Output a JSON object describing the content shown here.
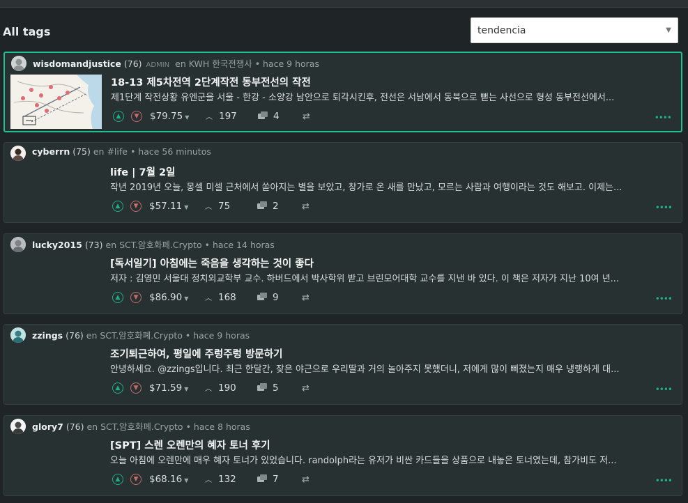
{
  "header": {
    "title": "All tags"
  },
  "sort_select": {
    "value": "tendencia"
  },
  "colors": {
    "accent": "#1fbf8f",
    "upvote": "#1fae87",
    "downvote": "#c76a6a",
    "background": "#1f2526",
    "card": "#273132"
  },
  "posts": [
    {
      "author": "wisdomandjustice",
      "rep": "(76)",
      "badge": "ADMIN",
      "community": "en KWH 한국전쟁사",
      "time": "• hace 9 horas",
      "title": "18-13 제5차전역 2단계작전 동부전선의 작전",
      "body": "제1단계 작전상황 유엔군을 서울 - 한강 - 소양강 남안으로 퇴각시킨후, 전선은 서남에서 동북으로 뻗는 사선으로 형성 동부전선에서...",
      "payout": "$79.75",
      "votes": "197",
      "comments": "4",
      "has_thumb": true
    },
    {
      "author": "cyberrn",
      "rep": "(75)",
      "badge": "",
      "community": "en #life",
      "time": "• hace 56 minutos",
      "title": "life | 7월 2일",
      "body": "작년 2019년 오늘, 몽셀 미셀 근처에서 쏟아지는 별을 보았고, 창가로 온 새를 만났고, 모르는 사람과 여행이라는 것도 해보고. 이제는...",
      "payout": "$57.11",
      "votes": "75",
      "comments": "2",
      "has_thumb": false
    },
    {
      "author": "lucky2015",
      "rep": "(73)",
      "badge": "",
      "community": "en SCT.암호화폐.Crypto",
      "time": "• hace 14 horas",
      "title": "[독서일기] 아침에는 죽음을 생각하는 것이 좋다",
      "body": "저자 : 김영민 서울대 정치외교학부 교수. 하버드에서 박사학위 받고 브린모어대학 교수를 지낸 바 있다. 이 책은 저자가 지난 10여 년...",
      "payout": "$86.90",
      "votes": "168",
      "comments": "9",
      "has_thumb": false
    },
    {
      "author": "zzings",
      "rep": "(76)",
      "badge": "",
      "community": "en SCT.암호화폐.Crypto",
      "time": "• hace 9 horas",
      "title": "조기퇴근하여, 평일에 주렁주렁 방문하기",
      "body": "안녕하세요. @zzings입니다. 최근 한달간, 잦은 야근으로 우리딸과 거의 놀아주지 못했더니, 저에게 많이 삐졌는지 매우 냉랭하게 대...",
      "payout": "$71.59",
      "votes": "190",
      "comments": "5",
      "has_thumb": false
    },
    {
      "author": "glory7",
      "rep": "(76)",
      "badge": "",
      "community": "en SCT.암호화폐.Crypto",
      "time": "• hace 8 horas",
      "title": "[SPT] 스렌 오렌만의 혜자 토너 후기",
      "body": "오늘 아침에 오렌만에 매우 혜자 토너가 있었습니다. randolph라는 유저가 비싼 카드들을 상품으로 내놓은 토너였는데, 참가비도 저...",
      "payout": "$68.16",
      "votes": "132",
      "comments": "7",
      "has_thumb": false
    }
  ]
}
